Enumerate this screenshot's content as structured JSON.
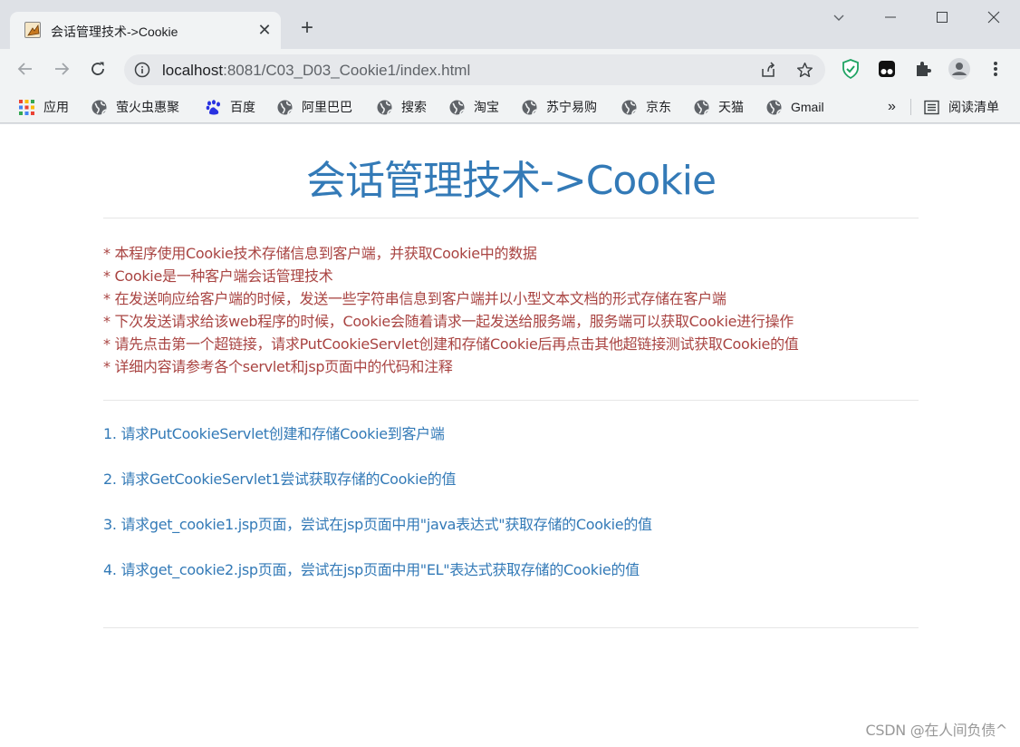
{
  "tab": {
    "title": "会话管理技术->Cookie",
    "close": "✕",
    "new_tab": "+"
  },
  "window": {
    "minimize": "—",
    "maximize": "☐",
    "close": "✕"
  },
  "toolbar": {
    "url_host": "localhost",
    "url_path": ":8081/C03_D03_Cookie1/index.html"
  },
  "bookmarks": {
    "items": [
      {
        "label": "应用",
        "icon": "apps-grid-icon"
      },
      {
        "label": "萤火虫惠聚",
        "icon": "globe-icon"
      },
      {
        "label": "百度",
        "icon": "baidu-paw-icon"
      },
      {
        "label": "阿里巴巴",
        "icon": "globe-icon"
      },
      {
        "label": "搜索",
        "icon": "globe-icon"
      },
      {
        "label": "淘宝",
        "icon": "globe-icon"
      },
      {
        "label": "苏宁易购",
        "icon": "globe-icon"
      },
      {
        "label": "京东",
        "icon": "globe-icon"
      },
      {
        "label": "天猫",
        "icon": "globe-icon"
      },
      {
        "label": "Gmail",
        "icon": "globe-icon"
      }
    ],
    "overflow": "»",
    "reading_list": "阅读清单"
  },
  "page": {
    "title": "会话管理技术->Cookie",
    "notes": [
      "* 本程序使用Cookie技术存储信息到客户端，并获取Cookie中的数据",
      "* Cookie是一种客户端会话管理技术",
      "* 在发送响应给客户端的时候，发送一些字符串信息到客户端并以小型文本文档的形式存储在客户端",
      "* 下次发送请求给该web程序的时候，Cookie会随着请求一起发送给服务端，服务端可以获取Cookie进行操作",
      "* 请先点击第一个超链接，请求PutCookieServlet创建和存储Cookie后再点击其他超链接测试获取Cookie的值",
      "* 详细内容请参考各个servlet和jsp页面中的代码和注释"
    ],
    "links": [
      "1. 请求PutCookieServlet创建和存储Cookie到客户端",
      "2. 请求GetCookieServlet1尝试获取存储的Cookie的值",
      "3. 请求get_cookie1.jsp页面，尝试在jsp页面中用\"java表达式\"获取存储的Cookie的值",
      "4. 请求get_cookie2.jsp页面，尝试在jsp页面中用\"EL\"表达式获取存储的Cookie的值"
    ]
  },
  "watermark": "CSDN @在人间负债^",
  "colors": {
    "title": "#337ab7",
    "note_text": "#a94442",
    "link_text": "#337ab7",
    "shield": "#1ea362"
  }
}
